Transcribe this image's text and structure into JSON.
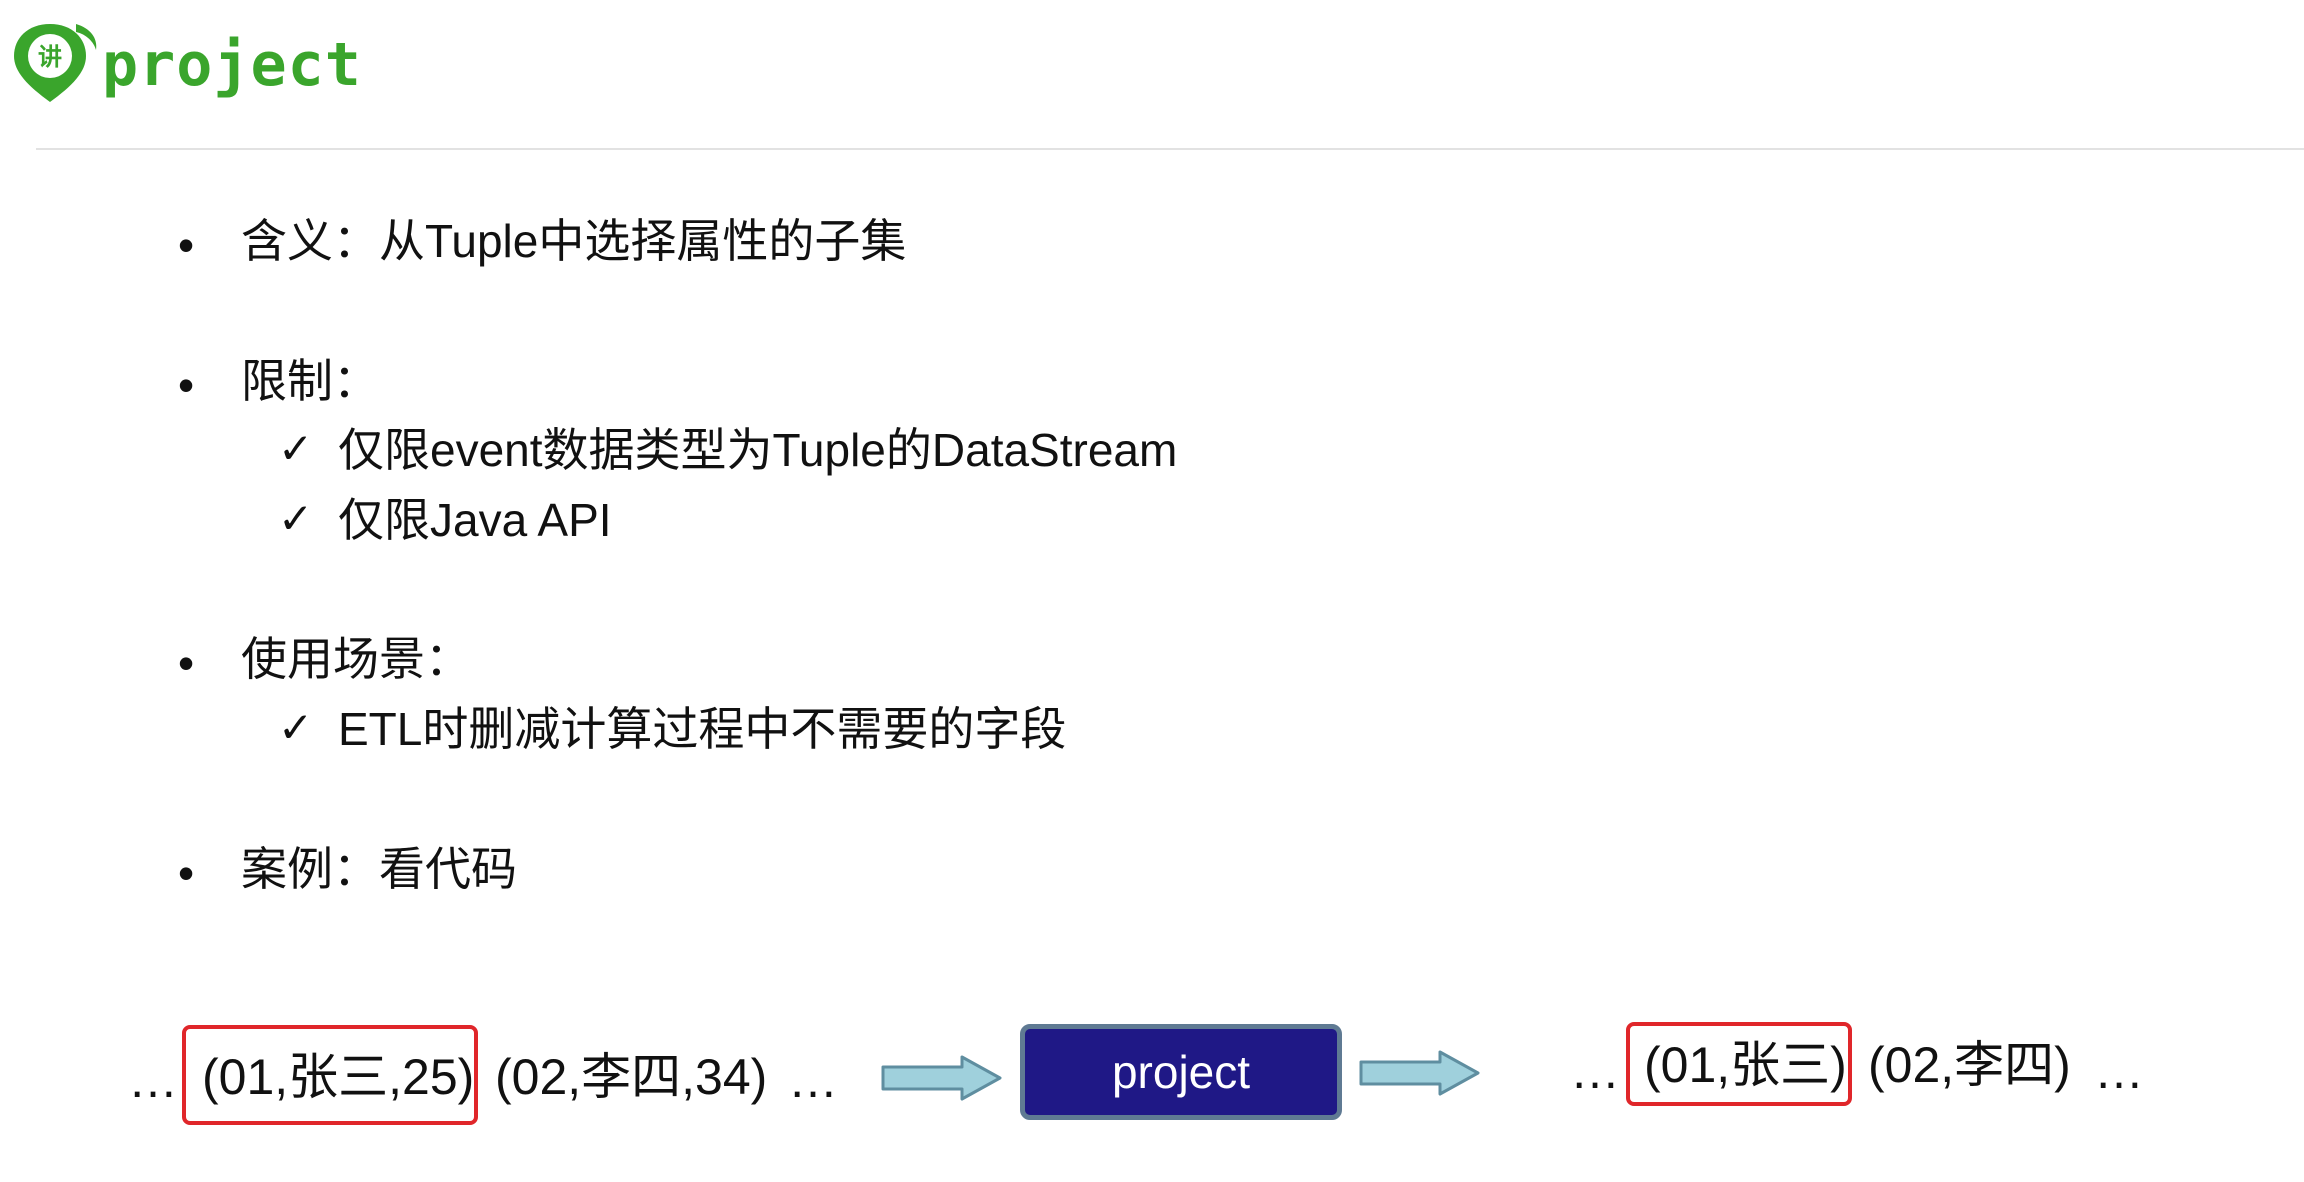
{
  "header": {
    "title": "project",
    "logo_char": "讲"
  },
  "bullets": [
    {
      "marker": "•",
      "text": "含义：从Tuple中选择属性的子集",
      "items": []
    },
    {
      "marker": "•",
      "text": "限制：",
      "items": [
        {
          "marker": "✓",
          "text": "仅限event数据类型为Tuple的DataStream"
        },
        {
          "marker": "✓",
          "text": "仅限Java API"
        }
      ]
    },
    {
      "marker": "•",
      "text": "使用场景：",
      "items": [
        {
          "marker": "✓",
          "text": "ETL时删减计算过程中不需要的字段"
        }
      ]
    },
    {
      "marker": "•",
      "text": "案例：看代码",
      "items": []
    }
  ],
  "diagram": {
    "input": {
      "ellipsis_left": "…",
      "highlighted": "(01,张三,25)",
      "rest": "(02,李四,34)",
      "ellipsis_right": "…"
    },
    "operator": "project",
    "output": {
      "ellipsis_left": "…",
      "highlighted": "(01,张三)",
      "rest": "(02,李四)",
      "ellipsis_right": "…"
    }
  },
  "colors": {
    "title": "#3aa52c",
    "operator_fill": "#1f1886",
    "operator_border": "#5f7a93",
    "highlight_border": "#e0262a",
    "arrow_fill": "#9fd0dc",
    "arrow_stroke": "#5f8ea0"
  }
}
